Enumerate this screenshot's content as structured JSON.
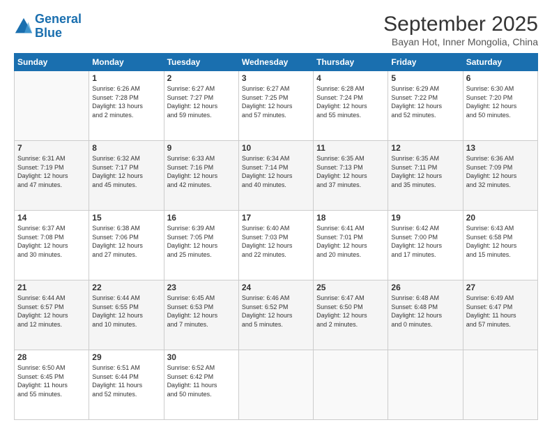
{
  "header": {
    "logo_line1": "General",
    "logo_line2": "Blue",
    "title": "September 2025",
    "subtitle": "Bayan Hot, Inner Mongolia, China"
  },
  "days_of_week": [
    "Sunday",
    "Monday",
    "Tuesday",
    "Wednesday",
    "Thursday",
    "Friday",
    "Saturday"
  ],
  "weeks": [
    [
      {
        "day": "",
        "info": ""
      },
      {
        "day": "1",
        "info": "Sunrise: 6:26 AM\nSunset: 7:28 PM\nDaylight: 13 hours\nand 2 minutes."
      },
      {
        "day": "2",
        "info": "Sunrise: 6:27 AM\nSunset: 7:27 PM\nDaylight: 12 hours\nand 59 minutes."
      },
      {
        "day": "3",
        "info": "Sunrise: 6:27 AM\nSunset: 7:25 PM\nDaylight: 12 hours\nand 57 minutes."
      },
      {
        "day": "4",
        "info": "Sunrise: 6:28 AM\nSunset: 7:24 PM\nDaylight: 12 hours\nand 55 minutes."
      },
      {
        "day": "5",
        "info": "Sunrise: 6:29 AM\nSunset: 7:22 PM\nDaylight: 12 hours\nand 52 minutes."
      },
      {
        "day": "6",
        "info": "Sunrise: 6:30 AM\nSunset: 7:20 PM\nDaylight: 12 hours\nand 50 minutes."
      }
    ],
    [
      {
        "day": "7",
        "info": "Sunrise: 6:31 AM\nSunset: 7:19 PM\nDaylight: 12 hours\nand 47 minutes."
      },
      {
        "day": "8",
        "info": "Sunrise: 6:32 AM\nSunset: 7:17 PM\nDaylight: 12 hours\nand 45 minutes."
      },
      {
        "day": "9",
        "info": "Sunrise: 6:33 AM\nSunset: 7:16 PM\nDaylight: 12 hours\nand 42 minutes."
      },
      {
        "day": "10",
        "info": "Sunrise: 6:34 AM\nSunset: 7:14 PM\nDaylight: 12 hours\nand 40 minutes."
      },
      {
        "day": "11",
        "info": "Sunrise: 6:35 AM\nSunset: 7:13 PM\nDaylight: 12 hours\nand 37 minutes."
      },
      {
        "day": "12",
        "info": "Sunrise: 6:35 AM\nSunset: 7:11 PM\nDaylight: 12 hours\nand 35 minutes."
      },
      {
        "day": "13",
        "info": "Sunrise: 6:36 AM\nSunset: 7:09 PM\nDaylight: 12 hours\nand 32 minutes."
      }
    ],
    [
      {
        "day": "14",
        "info": "Sunrise: 6:37 AM\nSunset: 7:08 PM\nDaylight: 12 hours\nand 30 minutes."
      },
      {
        "day": "15",
        "info": "Sunrise: 6:38 AM\nSunset: 7:06 PM\nDaylight: 12 hours\nand 27 minutes."
      },
      {
        "day": "16",
        "info": "Sunrise: 6:39 AM\nSunset: 7:05 PM\nDaylight: 12 hours\nand 25 minutes."
      },
      {
        "day": "17",
        "info": "Sunrise: 6:40 AM\nSunset: 7:03 PM\nDaylight: 12 hours\nand 22 minutes."
      },
      {
        "day": "18",
        "info": "Sunrise: 6:41 AM\nSunset: 7:01 PM\nDaylight: 12 hours\nand 20 minutes."
      },
      {
        "day": "19",
        "info": "Sunrise: 6:42 AM\nSunset: 7:00 PM\nDaylight: 12 hours\nand 17 minutes."
      },
      {
        "day": "20",
        "info": "Sunrise: 6:43 AM\nSunset: 6:58 PM\nDaylight: 12 hours\nand 15 minutes."
      }
    ],
    [
      {
        "day": "21",
        "info": "Sunrise: 6:44 AM\nSunset: 6:57 PM\nDaylight: 12 hours\nand 12 minutes."
      },
      {
        "day": "22",
        "info": "Sunrise: 6:44 AM\nSunset: 6:55 PM\nDaylight: 12 hours\nand 10 minutes."
      },
      {
        "day": "23",
        "info": "Sunrise: 6:45 AM\nSunset: 6:53 PM\nDaylight: 12 hours\nand 7 minutes."
      },
      {
        "day": "24",
        "info": "Sunrise: 6:46 AM\nSunset: 6:52 PM\nDaylight: 12 hours\nand 5 minutes."
      },
      {
        "day": "25",
        "info": "Sunrise: 6:47 AM\nSunset: 6:50 PM\nDaylight: 12 hours\nand 2 minutes."
      },
      {
        "day": "26",
        "info": "Sunrise: 6:48 AM\nSunset: 6:48 PM\nDaylight: 12 hours\nand 0 minutes."
      },
      {
        "day": "27",
        "info": "Sunrise: 6:49 AM\nSunset: 6:47 PM\nDaylight: 11 hours\nand 57 minutes."
      }
    ],
    [
      {
        "day": "28",
        "info": "Sunrise: 6:50 AM\nSunset: 6:45 PM\nDaylight: 11 hours\nand 55 minutes."
      },
      {
        "day": "29",
        "info": "Sunrise: 6:51 AM\nSunset: 6:44 PM\nDaylight: 11 hours\nand 52 minutes."
      },
      {
        "day": "30",
        "info": "Sunrise: 6:52 AM\nSunset: 6:42 PM\nDaylight: 11 hours\nand 50 minutes."
      },
      {
        "day": "",
        "info": ""
      },
      {
        "day": "",
        "info": ""
      },
      {
        "day": "",
        "info": ""
      },
      {
        "day": "",
        "info": ""
      }
    ]
  ]
}
